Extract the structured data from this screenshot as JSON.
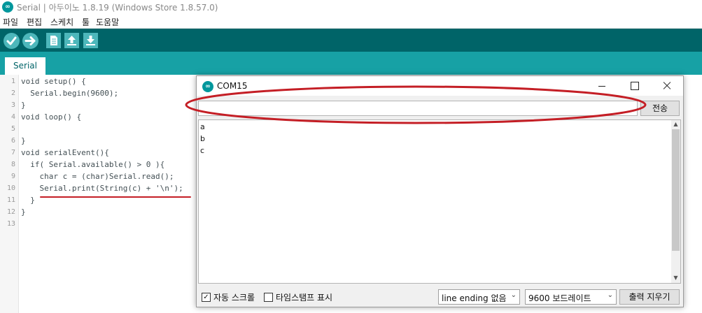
{
  "app": {
    "title": "Serial | 아두이노 1.8.19 (Windows Store 1.8.57.0)",
    "logo_text": "∞"
  },
  "menu": {
    "items": [
      "파일",
      "편집",
      "스케치",
      "툴",
      "도움말"
    ]
  },
  "toolbar": {
    "buttons": [
      "verify-icon",
      "upload-icon",
      "new-icon",
      "open-icon",
      "save-icon"
    ]
  },
  "tabs": [
    {
      "label": "Serial"
    }
  ],
  "editor": {
    "line_numbers": [
      "1",
      "2",
      "3",
      "4",
      "5",
      "6",
      "7",
      "8",
      "9",
      "10",
      "11",
      "12",
      "13"
    ],
    "code": [
      "void setup() {",
      "  Serial.begin(9600);",
      "}",
      "void loop() {",
      "",
      "}",
      "void serialEvent(){",
      "  if( Serial.available() > 0 ){",
      "    char c = (char)Serial.read();",
      "    Serial.print(String(c) + '\\n');",
      "  }",
      "}",
      ""
    ]
  },
  "serial_monitor": {
    "title": "COM15",
    "input_value": "",
    "send_label": "전송",
    "output_lines": [
      "a",
      "b",
      "c"
    ],
    "autoscroll_label": "자동 스크롤",
    "autoscroll_checked": true,
    "timestamp_label": "타임스탬프 표시",
    "timestamp_checked": false,
    "line_ending": "line ending 없음",
    "baud_rate": "9600 보드레이트",
    "clear_label": "출력 지우기"
  },
  "colors": {
    "toolbar_bg": "#006468",
    "tabstrip_bg": "#17a1a5",
    "toolbar_button": "#4db7bb",
    "keyword": "#00979c",
    "function": "#d35400",
    "annotation": "#c41e25"
  }
}
